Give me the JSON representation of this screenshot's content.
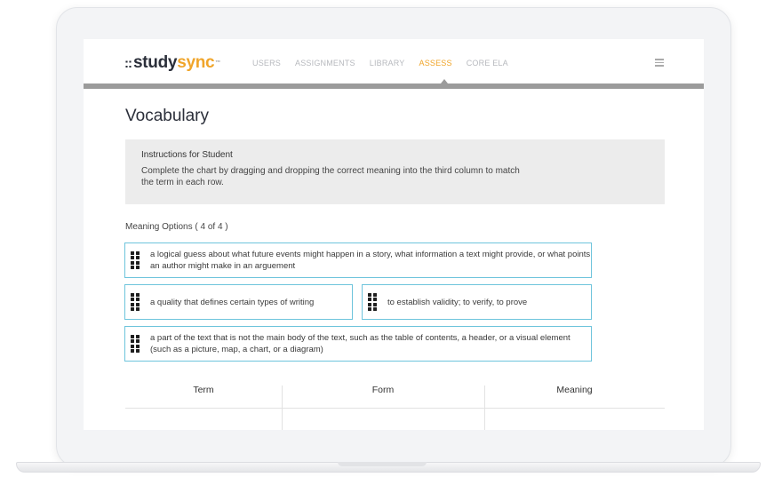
{
  "logo": {
    "dots": "::",
    "study": "study",
    "sync": "sync",
    "tm": "™"
  },
  "nav": [
    {
      "label": "USERS"
    },
    {
      "label": "ASSIGNMENTS"
    },
    {
      "label": "LIBRARY"
    },
    {
      "label": "ASSESS",
      "active": true
    },
    {
      "label": "CORE ELA"
    }
  ],
  "page": {
    "title": "Vocabulary"
  },
  "instructions": {
    "heading": "Instructions for Student",
    "body": "Complete the chart by dragging and dropping the correct meaning into the third column to match the term in each row."
  },
  "options": {
    "label": "Meaning Options ( 4 of 4 )",
    "items": [
      "a logical guess about what future events might happen in a story, what information a text might provide, or what points an author might make in an arguement",
      "a quality that defines certain types of writing",
      "to establish validity; to verify, to prove",
      "a part of the text that is not the main body of the text, such as the table of contents, a header, or a visual element (such as a picture, map, a chart, or a diagram)"
    ]
  },
  "table": {
    "columns": [
      "Term",
      "Form",
      "Meaning"
    ]
  },
  "colors": {
    "accent": "#f0a52a",
    "option_border": "#6ec4dc",
    "nav_bar": "#9b9b9b"
  }
}
